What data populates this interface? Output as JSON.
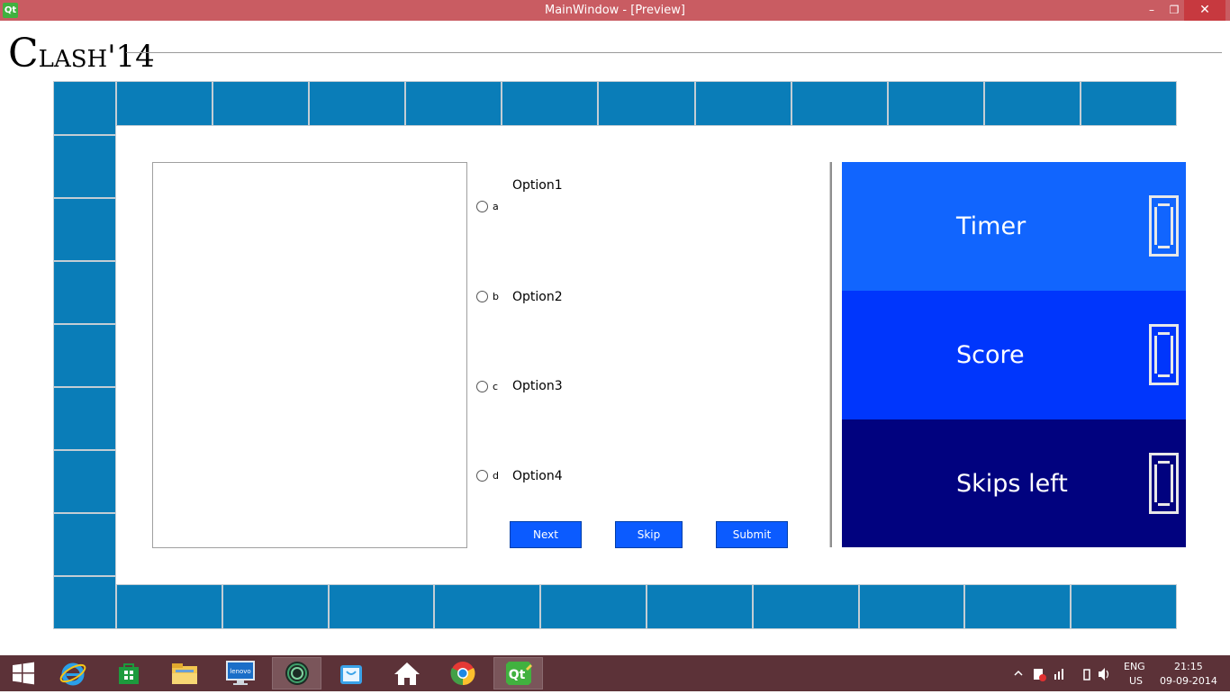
{
  "window": {
    "title": "MainWindow - [Preview]",
    "app_icon": "Qt",
    "minimize": "–",
    "restore": "❐",
    "close": "✕"
  },
  "logo": {
    "big_c": "C",
    "small": "LASH",
    "suffix": "'14"
  },
  "options": [
    {
      "letter": "a",
      "label": "Option1"
    },
    {
      "letter": "b",
      "label": "Option2"
    },
    {
      "letter": "c",
      "label": "Option3"
    },
    {
      "letter": "d",
      "label": "Option4"
    }
  ],
  "buttons": {
    "next": "Next",
    "skip": "Skip",
    "submit": "Submit"
  },
  "panels": [
    {
      "label": "Timer",
      "color": "#1165fe"
    },
    {
      "label": "Score",
      "color": "#0036fc"
    },
    {
      "label": "Skips left",
      "color": "#01027f"
    }
  ],
  "colors": {
    "tile": "#0a7db8",
    "titlebar": "#c95c62",
    "button": "#0b5bff",
    "taskbar": "#5c3238"
  },
  "taskbar": {
    "icons": [
      "start-icon",
      "internet-explorer-icon",
      "store-icon",
      "file-explorer-icon",
      "lenovo-icon",
      "circle-app-icon",
      "shopping-bag-icon",
      "home-icon",
      "chrome-icon",
      "qt-creator-icon"
    ],
    "lenovo_text": "lenovo",
    "qt_text": "Qt",
    "language": "ENG",
    "region": "US",
    "time": "21:15",
    "date": "09-09-2014"
  }
}
